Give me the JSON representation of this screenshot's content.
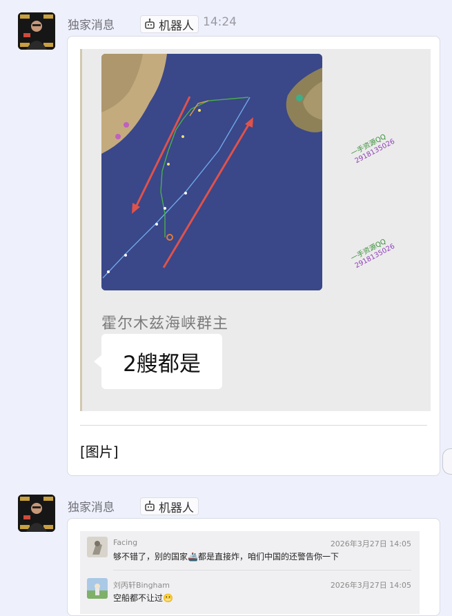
{
  "messages": [
    {
      "sender": "独家消息",
      "tag": "机器人",
      "time": "14:24",
      "forwarded": {
        "group_name": "霍尔木兹海峡群主",
        "bubble_text": "2艘都是",
        "watermark_line1": "一手资源QQ",
        "watermark_line2": "2918135026"
      },
      "caption": "[图片]"
    },
    {
      "sender": "独家消息",
      "tag": "机器人",
      "comments": [
        {
          "name": "Facing",
          "date": "2026年3月27日 14:05",
          "text": "够不错了，别的国家🚢都是直接炸，咱们中国的还警告你一下"
        },
        {
          "name": "刘丙轩Bingham",
          "date": "2026年3月27日 14:05",
          "text": "空船都不让过😬"
        }
      ]
    }
  ],
  "colors": {
    "background": "#eef0fb",
    "sea": "#3a4789",
    "land": "#c4ab7e",
    "arrow": "#e0524a",
    "route": "#6fa8e8"
  },
  "icons": {
    "robot": "robot-icon",
    "side_button": "comment-bubble-icon"
  }
}
